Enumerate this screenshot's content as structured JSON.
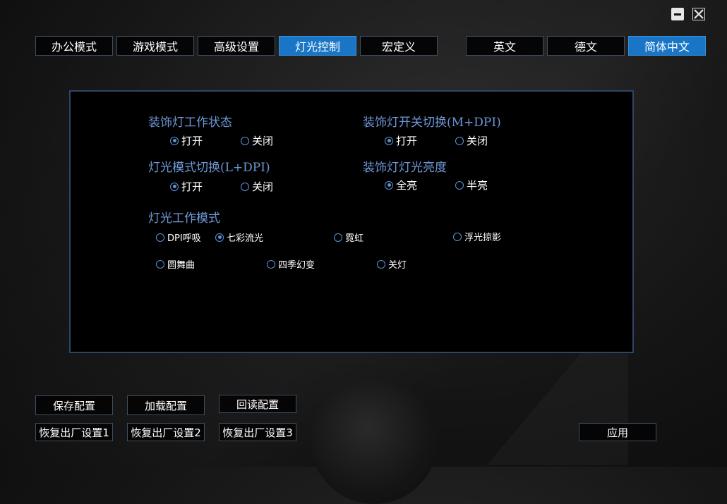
{
  "window": {
    "minimize_icon": "minimize-icon",
    "close_icon": "close-icon"
  },
  "mode_tabs": [
    {
      "label": "办公模式",
      "active": false
    },
    {
      "label": "游戏模式",
      "active": false
    },
    {
      "label": "高级设置",
      "active": false
    },
    {
      "label": "灯光控制",
      "active": true
    },
    {
      "label": "宏定义",
      "active": false
    }
  ],
  "language_tabs": [
    {
      "label": "英文",
      "active": false
    },
    {
      "label": "德文",
      "active": false
    },
    {
      "label": "简体中文",
      "active": true
    }
  ],
  "panel": {
    "deco_light_state": {
      "title": "装饰灯工作状态",
      "options": [
        {
          "label": "打开",
          "checked": true
        },
        {
          "label": "关闭",
          "checked": false
        }
      ]
    },
    "deco_light_switch": {
      "title": "装饰灯开关切换(M+DPI)",
      "options": [
        {
          "label": "打开",
          "checked": true
        },
        {
          "label": "关闭",
          "checked": false
        }
      ]
    },
    "light_mode_switch": {
      "title": "灯光模式切换(L+DPI)",
      "options": [
        {
          "label": "打开",
          "checked": true
        },
        {
          "label": "关闭",
          "checked": false
        }
      ]
    },
    "deco_brightness": {
      "title": "装饰灯灯光亮度",
      "options": [
        {
          "label": "全亮",
          "checked": true
        },
        {
          "label": "半亮",
          "checked": false
        }
      ]
    },
    "light_work_mode": {
      "title": "灯光工作模式",
      "options": [
        {
          "label": "DPI呼吸",
          "checked": false
        },
        {
          "label": "七彩流光",
          "checked": true
        },
        {
          "label": "霓虹",
          "checked": false
        },
        {
          "label": "浮光掠影",
          "checked": false
        },
        {
          "label": "圆舞曲",
          "checked": false
        },
        {
          "label": "四季幻变",
          "checked": false
        },
        {
          "label": "关灯",
          "checked": false
        }
      ]
    }
  },
  "bottom": {
    "save_config": "保存配置",
    "load_config": "加载配置",
    "readback_config": "回读配置",
    "restore1": "恢复出厂设置1",
    "restore2": "恢复出厂设置2",
    "restore3": "恢复出厂设置3",
    "apply": "应用"
  },
  "colors": {
    "accent": "#1976c6",
    "group_title": "#6f98d6",
    "panel_border": "#2b4765"
  }
}
